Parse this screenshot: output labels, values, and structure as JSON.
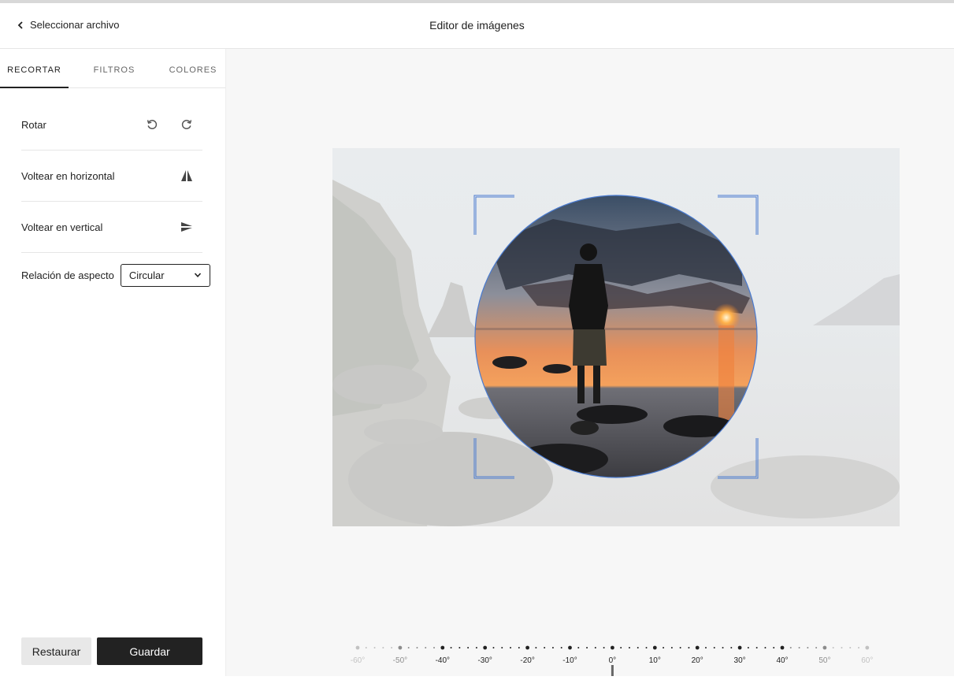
{
  "header": {
    "back_label": "Seleccionar archivo",
    "title": "Editor de imágenes"
  },
  "tabs": [
    {
      "label": "RECORTAR",
      "active": true
    },
    {
      "label": "FILTROS",
      "active": false
    },
    {
      "label": "COLORES",
      "active": false
    }
  ],
  "crop": {
    "rotate_label": "Rotar",
    "flip_h_label": "Voltear en horizontal",
    "flip_v_label": "Voltear en vertical",
    "aspect_label": "Relación de aspecto",
    "aspect_value": "Circular"
  },
  "buttons": {
    "reset": "Restaurar",
    "save": "Guardar"
  },
  "rotation": {
    "current_deg": 0,
    "ticks": [
      "-60°",
      "-50°",
      "-40°",
      "-30°",
      "-20°",
      "-10°",
      "0°",
      "10°",
      "20°",
      "30°",
      "40°",
      "50°",
      "60°"
    ]
  },
  "colors": {
    "accent": "#4a7bd0",
    "dark": "#222222"
  },
  "icons": {
    "back": "chevron-left-icon",
    "rotate_left": "rotate-left-icon",
    "rotate_right": "rotate-right-icon",
    "flip_h": "flip-horizontal-icon",
    "flip_v": "flip-vertical-icon",
    "dropdown": "chevron-down-icon"
  }
}
